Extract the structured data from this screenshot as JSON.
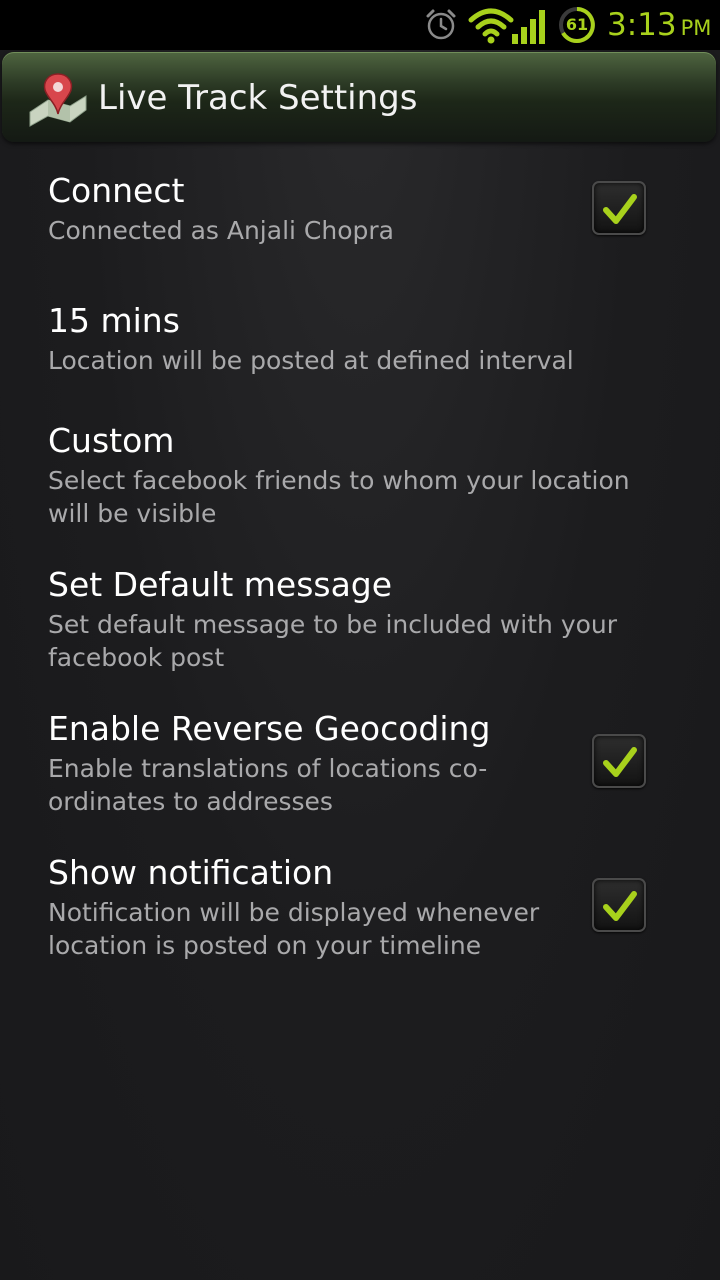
{
  "status_bar": {
    "battery_level": "61",
    "time": "3:13",
    "ampm": "PM",
    "icons": [
      "alarm-icon",
      "wifi-icon",
      "signal-icon",
      "battery-icon"
    ],
    "accent_color": "#a8d11c"
  },
  "header": {
    "title": "Live Track Settings",
    "icon": "map-pin-icon"
  },
  "preferences": [
    {
      "title": "Connect",
      "summary": "Connected as Anjali Chopra",
      "checkbox": true,
      "checked": true
    },
    {
      "title": "15 mins",
      "summary": "Location will be posted at defined interval",
      "checkbox": false
    },
    {
      "title": "Custom",
      "summary": "Select facebook friends to whom your location will be visible",
      "checkbox": false
    },
    {
      "title": "Set Default message",
      "summary": "Set default message to be included with your facebook post",
      "checkbox": false
    },
    {
      "title": "Enable Reverse Geocoding",
      "summary": "Enable translations of locations co-ordinates to addresses",
      "checkbox": true,
      "checked": true
    },
    {
      "title": "Show notification",
      "summary": "Notification will be displayed whenever location is posted on your timeline",
      "checkbox": true,
      "checked": true
    }
  ],
  "colors": {
    "background": "#1b1b1d",
    "title_text": "#ffffff",
    "summary_text": "#a9a9ab",
    "checkmark": "#a8d11c"
  }
}
